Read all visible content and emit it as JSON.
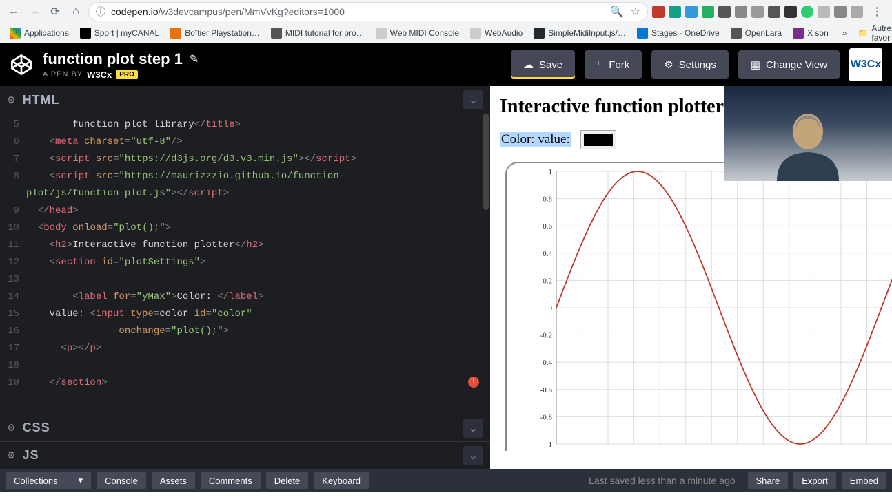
{
  "browser": {
    "url_host": "codepen.io",
    "url_path": "/w3devcampus/pen/MmVvKg?editors=1000",
    "bookmarks": [
      {
        "label": "Applications",
        "color": "#db4437"
      },
      {
        "label": "Sport | myCANAL",
        "color": "#000"
      },
      {
        "label": "Boîtier Playstation…",
        "color": "#e8710a"
      },
      {
        "label": "MIDI tutorial for pro…",
        "color": "#555"
      },
      {
        "label": "Web MIDI Console",
        "color": "#ccc"
      },
      {
        "label": "WebAudio",
        "color": "#ccc"
      },
      {
        "label": "SimpleMidiInput.js/…",
        "color": "#24292e"
      },
      {
        "label": "Stages - OneDrive",
        "color": "#0078d4"
      },
      {
        "label": "OpenLara",
        "color": "#555"
      },
      {
        "label": "X son",
        "color": "#7b2d8e"
      }
    ],
    "other_favs": "Autres favoris"
  },
  "codepen": {
    "title": "function plot step 1",
    "subtitle_prefix": "A PEN BY",
    "author": "W3Cx",
    "pro": "PRO",
    "buttons": {
      "save": "Save",
      "fork": "Fork",
      "settings": "Settings",
      "change_view": "Change View"
    },
    "avatar": "W3Cx"
  },
  "panels": {
    "html": "HTML",
    "css": "CSS",
    "js": "JS"
  },
  "code_lines": [
    {
      "n": "5",
      "indent": "        ",
      "html": "<span class='text'>function plot library</span><span class='punct'>&lt;/</span><span class='tag'>title</span><span class='punct'>&gt;</span>"
    },
    {
      "n": "6",
      "indent": "    ",
      "html": "<span class='punct'>&lt;</span><span class='tag'>meta</span> <span class='attr'>charset</span><span class='punct'>=</span><span class='string'>\"utf-8\"</span><span class='punct'>/&gt;</span>"
    },
    {
      "n": "7",
      "indent": "    ",
      "html": "<span class='punct'>&lt;</span><span class='tag'>script</span> <span class='attr'>src</span><span class='punct'>=</span><span class='string'>\"https://d3js.org/d3.v3.min.js\"</span><span class='punct'>&gt;&lt;/</span><span class='tag'>script</span><span class='punct'>&gt;</span>"
    },
    {
      "n": "8",
      "indent": "    ",
      "html": "<span class='punct'>&lt;</span><span class='tag'>script</span> <span class='attr'>src</span><span class='punct'>=</span><span class='string'>\"https://maurizzzio.github.io/function-</span>"
    },
    {
      "n": "",
      "indent": "",
      "html": "<span class='string'>plot/js/function-plot.js\"</span><span class='punct'>&gt;&lt;/</span><span class='tag'>script</span><span class='punct'>&gt;</span>"
    },
    {
      "n": "9",
      "indent": "  ",
      "html": "<span class='punct'>&lt;/</span><span class='tag'>head</span><span class='punct'>&gt;</span>"
    },
    {
      "n": "10",
      "indent": "  ",
      "html": "<span class='punct'>&lt;</span><span class='tag'>body</span> <span class='attr'>onload</span><span class='punct'>=</span><span class='string'>\"plot();\"</span><span class='punct'>&gt;</span>"
    },
    {
      "n": "11",
      "indent": "    ",
      "html": "<span class='punct'>&lt;</span><span class='tag'>h2</span><span class='punct'>&gt;</span><span class='text'>Interactive function plotter</span><span class='punct'>&lt;/</span><span class='tag'>h2</span><span class='punct'>&gt;</span>"
    },
    {
      "n": "12",
      "indent": "    ",
      "html": "<span class='punct'>&lt;</span><span class='tag'>section</span> <span class='attr'>id</span><span class='punct'>=</span><span class='string'>\"plotSettings\"</span><span class='punct'>&gt;</span>"
    },
    {
      "n": "13",
      "indent": "",
      "html": ""
    },
    {
      "n": "14",
      "indent": "        ",
      "html": "<span class='punct'>&lt;</span><span class='tag'>label</span> <span class='attr'>for</span><span class='punct'>=</span><span class='string'>\"yMax\"</span><span class='punct'>&gt;</span><span class='text'>Color: </span><span class='punct'>&lt;/</span><span class='tag'>label</span><span class='punct'>&gt;</span>"
    },
    {
      "n": "15",
      "indent": "    ",
      "html": "<span class='text'>value: </span><span class='punct'>&lt;</span><span class='tag'>input</span> <span class='attr'>type</span><span class='punct'>=</span><span class='text'>color</span> <span class='attr'>id</span><span class='punct'>=</span><span class='string'>\"color\"</span>"
    },
    {
      "n": "16",
      "indent": "                ",
      "html": "<span class='attr'>onchange</span><span class='punct'>=</span><span class='string'>\"plot();\"</span><span class='punct'>&gt;</span>"
    },
    {
      "n": "17",
      "indent": "      ",
      "html": "<span class='punct'>&lt;</span><span class='tag'>p</span><span class='punct'>&gt;&lt;/</span><span class='tag'>p</span><span class='punct'>&gt;</span>"
    },
    {
      "n": "18",
      "indent": "",
      "html": ""
    },
    {
      "n": "19",
      "indent": "    ",
      "html": "<span class='punct'>&lt;/</span><span class='tag'>section</span><span class='punct'>&gt;</span>"
    }
  ],
  "preview": {
    "heading": "Interactive function plotter",
    "color_label": "Color: ",
    "value_label": "value:",
    "color_value": "#000000"
  },
  "chart_data": {
    "type": "line",
    "title": "",
    "xlabel": "",
    "ylabel": "",
    "xlim": [
      0,
      6.5
    ],
    "ylim": [
      -1,
      1
    ],
    "yticks": [
      -1,
      -0.8,
      -0.6,
      -0.4,
      -0.2,
      0,
      0.2,
      0.4,
      0.6,
      0.8,
      1
    ],
    "series": [
      {
        "name": "sin(x)",
        "color": "#c0392b",
        "fn": "sin",
        "samples": 120
      }
    ]
  },
  "footer": {
    "collections": "Collections",
    "console": "Console",
    "assets": "Assets",
    "comments": "Comments",
    "delete": "Delete",
    "keyboard": "Keyboard",
    "status": "Last saved less than a minute ago",
    "share": "Share",
    "export": "Export",
    "embed": "Embed"
  }
}
